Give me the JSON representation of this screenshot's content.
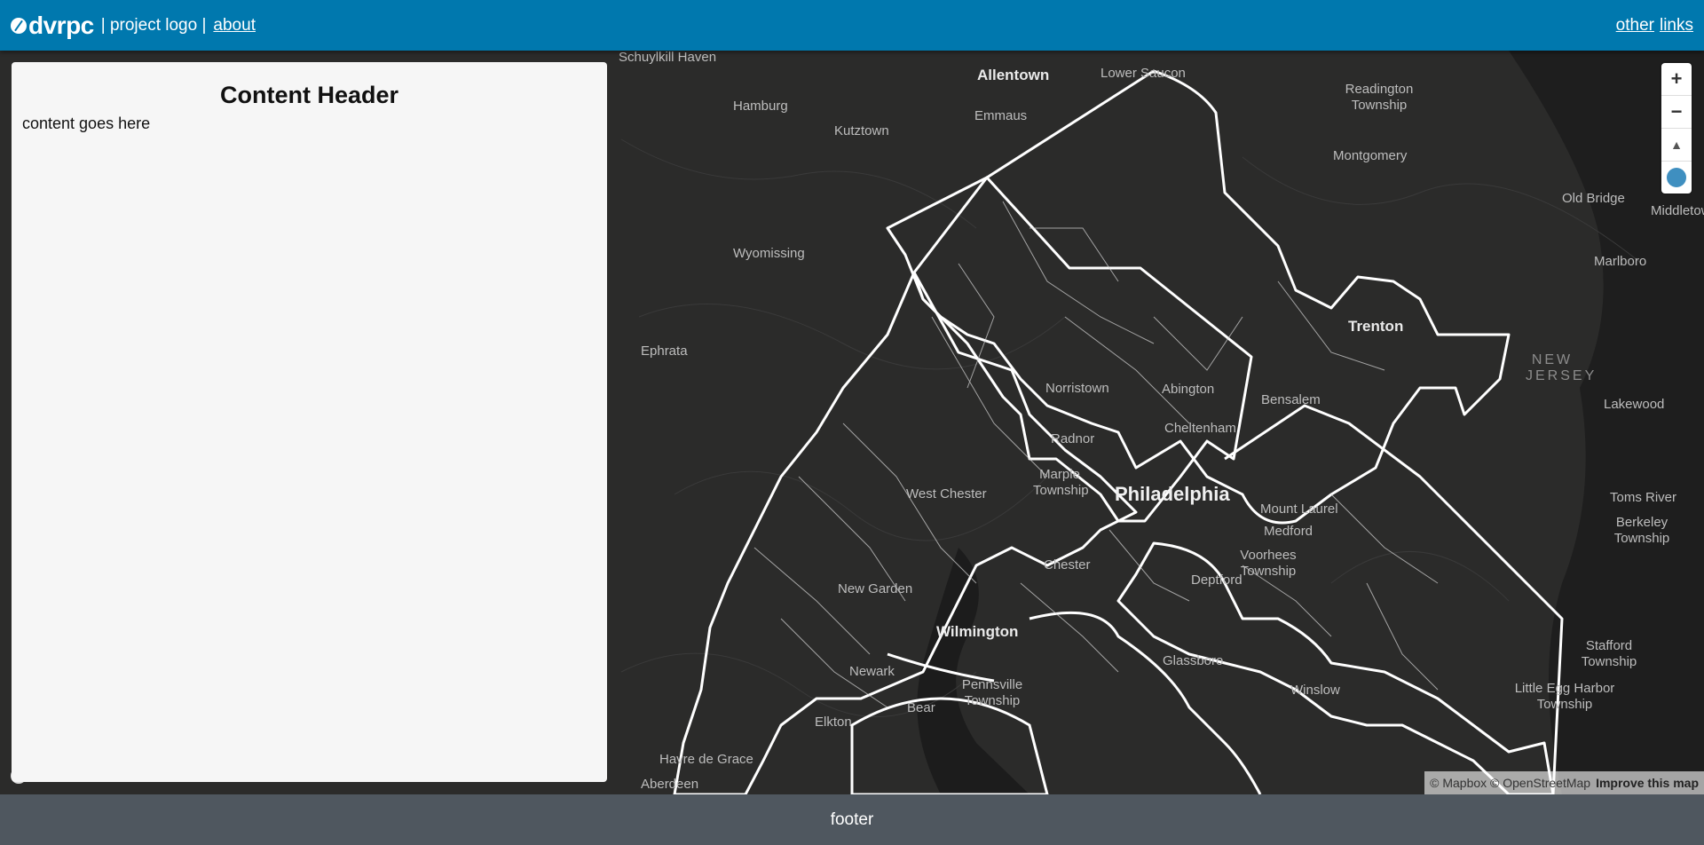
{
  "header": {
    "logo_text": "dvrpc",
    "project_logo": "| project logo |",
    "about": "about",
    "other": "other",
    "links": "links"
  },
  "panel": {
    "title": "Content Header",
    "body": "content goes here"
  },
  "map": {
    "controls": {
      "zoom_in": "+",
      "zoom_out": "−",
      "compass": "▲"
    },
    "labels": [
      "Schuylkill Haven",
      "Allentown",
      "Lower Saucon",
      "Readington Township",
      "Hamburg",
      "Emmaus",
      "Kutztown",
      "Montgomery",
      "Old Bridge",
      "Middletown",
      "Wyomissing",
      "Marlboro",
      "Trenton",
      "Ephrata",
      "NEW JERSEY",
      "Norristown",
      "Abington",
      "Bensalem",
      "Lakewood",
      "Radnor",
      "Cheltenham",
      "Marple Township",
      "Philadelphia",
      "West Chester",
      "Mount Laurel",
      "Toms River",
      "Medford",
      "Berkeley Township",
      "Chester",
      "Voorhees Township",
      "Deptford",
      "New Garden",
      "Wilmington",
      "Stafford Township",
      "Glassboro",
      "Newark",
      "Pennsville Township",
      "Winslow",
      "Little Egg Harbor Township",
      "Bear",
      "Elkton",
      "Havre de Grace",
      "Aberdeen"
    ],
    "attribution": "© Mapbox © OpenStreetMap",
    "improve": "Improve this map"
  },
  "footer": {
    "text": "footer"
  }
}
